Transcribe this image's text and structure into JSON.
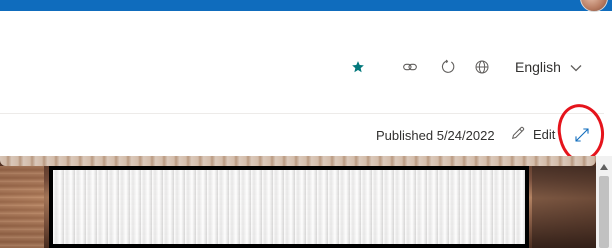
{
  "header": {
    "actions": [
      {
        "name": "follow",
        "icon": "star-icon",
        "color": "#03787c"
      },
      {
        "name": "share-link",
        "icon": "link-icon"
      },
      {
        "name": "refresh",
        "icon": "refresh-icon"
      },
      {
        "name": "language-globe",
        "icon": "globe-icon"
      }
    ],
    "language": {
      "selected": "English",
      "icon": "chevron-down-icon"
    }
  },
  "page_bar": {
    "published": "Published 5/24/2022",
    "edit_label": "Edit",
    "edit_icon": "pencil-icon",
    "expand_icon": "expand-icon",
    "annotation_color": "#e5141c"
  },
  "colors": {
    "top_bar": "#0f6cbd",
    "accent_star": "#03787c"
  }
}
